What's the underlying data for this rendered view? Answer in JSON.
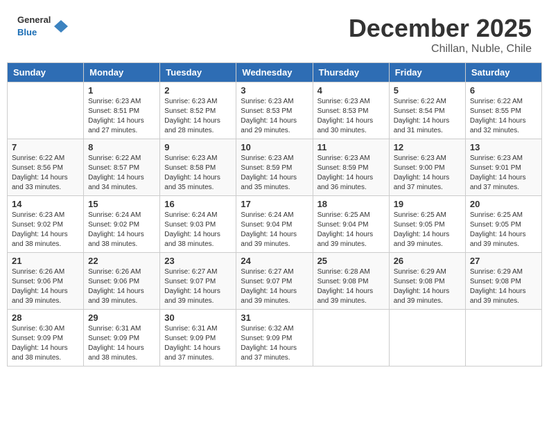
{
  "header": {
    "logo_general": "General",
    "logo_blue": "Blue",
    "month": "December 2025",
    "location": "Chillan, Nuble, Chile"
  },
  "weekdays": [
    "Sunday",
    "Monday",
    "Tuesday",
    "Wednesday",
    "Thursday",
    "Friday",
    "Saturday"
  ],
  "weeks": [
    [
      {
        "day": "",
        "info": ""
      },
      {
        "day": "1",
        "info": "Sunrise: 6:23 AM\nSunset: 8:51 PM\nDaylight: 14 hours\nand 27 minutes."
      },
      {
        "day": "2",
        "info": "Sunrise: 6:23 AM\nSunset: 8:52 PM\nDaylight: 14 hours\nand 28 minutes."
      },
      {
        "day": "3",
        "info": "Sunrise: 6:23 AM\nSunset: 8:53 PM\nDaylight: 14 hours\nand 29 minutes."
      },
      {
        "day": "4",
        "info": "Sunrise: 6:23 AM\nSunset: 8:53 PM\nDaylight: 14 hours\nand 30 minutes."
      },
      {
        "day": "5",
        "info": "Sunrise: 6:22 AM\nSunset: 8:54 PM\nDaylight: 14 hours\nand 31 minutes."
      },
      {
        "day": "6",
        "info": "Sunrise: 6:22 AM\nSunset: 8:55 PM\nDaylight: 14 hours\nand 32 minutes."
      }
    ],
    [
      {
        "day": "7",
        "info": "Sunrise: 6:22 AM\nSunset: 8:56 PM\nDaylight: 14 hours\nand 33 minutes."
      },
      {
        "day": "8",
        "info": "Sunrise: 6:22 AM\nSunset: 8:57 PM\nDaylight: 14 hours\nand 34 minutes."
      },
      {
        "day": "9",
        "info": "Sunrise: 6:23 AM\nSunset: 8:58 PM\nDaylight: 14 hours\nand 35 minutes."
      },
      {
        "day": "10",
        "info": "Sunrise: 6:23 AM\nSunset: 8:59 PM\nDaylight: 14 hours\nand 35 minutes."
      },
      {
        "day": "11",
        "info": "Sunrise: 6:23 AM\nSunset: 8:59 PM\nDaylight: 14 hours\nand 36 minutes."
      },
      {
        "day": "12",
        "info": "Sunrise: 6:23 AM\nSunset: 9:00 PM\nDaylight: 14 hours\nand 37 minutes."
      },
      {
        "day": "13",
        "info": "Sunrise: 6:23 AM\nSunset: 9:01 PM\nDaylight: 14 hours\nand 37 minutes."
      }
    ],
    [
      {
        "day": "14",
        "info": "Sunrise: 6:23 AM\nSunset: 9:02 PM\nDaylight: 14 hours\nand 38 minutes."
      },
      {
        "day": "15",
        "info": "Sunrise: 6:24 AM\nSunset: 9:02 PM\nDaylight: 14 hours\nand 38 minutes."
      },
      {
        "day": "16",
        "info": "Sunrise: 6:24 AM\nSunset: 9:03 PM\nDaylight: 14 hours\nand 38 minutes."
      },
      {
        "day": "17",
        "info": "Sunrise: 6:24 AM\nSunset: 9:04 PM\nDaylight: 14 hours\nand 39 minutes."
      },
      {
        "day": "18",
        "info": "Sunrise: 6:25 AM\nSunset: 9:04 PM\nDaylight: 14 hours\nand 39 minutes."
      },
      {
        "day": "19",
        "info": "Sunrise: 6:25 AM\nSunset: 9:05 PM\nDaylight: 14 hours\nand 39 minutes."
      },
      {
        "day": "20",
        "info": "Sunrise: 6:25 AM\nSunset: 9:05 PM\nDaylight: 14 hours\nand 39 minutes."
      }
    ],
    [
      {
        "day": "21",
        "info": "Sunrise: 6:26 AM\nSunset: 9:06 PM\nDaylight: 14 hours\nand 39 minutes."
      },
      {
        "day": "22",
        "info": "Sunrise: 6:26 AM\nSunset: 9:06 PM\nDaylight: 14 hours\nand 39 minutes."
      },
      {
        "day": "23",
        "info": "Sunrise: 6:27 AM\nSunset: 9:07 PM\nDaylight: 14 hours\nand 39 minutes."
      },
      {
        "day": "24",
        "info": "Sunrise: 6:27 AM\nSunset: 9:07 PM\nDaylight: 14 hours\nand 39 minutes."
      },
      {
        "day": "25",
        "info": "Sunrise: 6:28 AM\nSunset: 9:08 PM\nDaylight: 14 hours\nand 39 minutes."
      },
      {
        "day": "26",
        "info": "Sunrise: 6:29 AM\nSunset: 9:08 PM\nDaylight: 14 hours\nand 39 minutes."
      },
      {
        "day": "27",
        "info": "Sunrise: 6:29 AM\nSunset: 9:08 PM\nDaylight: 14 hours\nand 39 minutes."
      }
    ],
    [
      {
        "day": "28",
        "info": "Sunrise: 6:30 AM\nSunset: 9:09 PM\nDaylight: 14 hours\nand 38 minutes."
      },
      {
        "day": "29",
        "info": "Sunrise: 6:31 AM\nSunset: 9:09 PM\nDaylight: 14 hours\nand 38 minutes."
      },
      {
        "day": "30",
        "info": "Sunrise: 6:31 AM\nSunset: 9:09 PM\nDaylight: 14 hours\nand 37 minutes."
      },
      {
        "day": "31",
        "info": "Sunrise: 6:32 AM\nSunset: 9:09 PM\nDaylight: 14 hours\nand 37 minutes."
      },
      {
        "day": "",
        "info": ""
      },
      {
        "day": "",
        "info": ""
      },
      {
        "day": "",
        "info": ""
      }
    ]
  ]
}
